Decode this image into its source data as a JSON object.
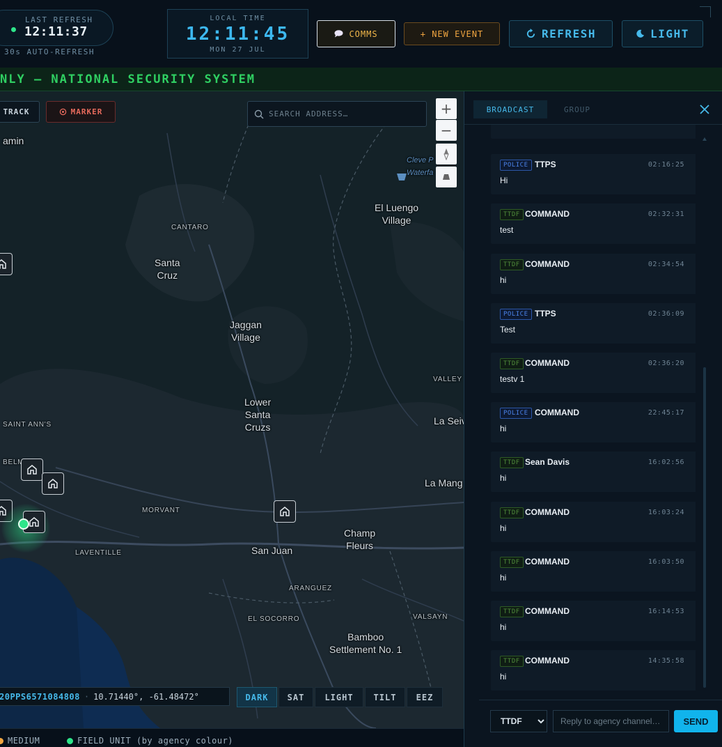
{
  "header": {
    "last_refresh_label": "LAST REFRESH",
    "last_refresh_time": "12:11:37",
    "auto_refresh": "30s AUTO-REFRESH",
    "clock_label": "LOCAL TIME",
    "clock_time": "12:11:45",
    "clock_date": "MON 27 JUL",
    "comms_label": "COMMS",
    "new_event_label": "+ NEW EVENT",
    "refresh_label": "REFRESH",
    "light_label": "LIGHT",
    "accent_color": "#46b9ea"
  },
  "banner": {
    "text": "NLY — NATIONAL SECURITY SYSTEM",
    "color": "#2fcf62"
  },
  "map": {
    "track_label": "TRACK",
    "marker_label": "MARKER",
    "search_placeholder": "SEARCH ADDRESS…",
    "zoom_in": "+",
    "zoom_out": "−",
    "places": {
      "amin": "amin",
      "cantaro": "CANTARO",
      "santa_cruz": "Santa\nCruz",
      "jaggan": "Jaggan\nVillage",
      "el_luengo": "El Luengo\nVillage",
      "cleve": "Cleve P\nWaterfa",
      "lower_santa_cruzs": "Lower\nSanta\nCruzs",
      "saint_anns": "SAINT ANN'S",
      "valley": "VALLEY",
      "la_seiv": "La Seiv",
      "belmont": "BELMONT",
      "la_mang": "La Mang",
      "morvant": "MORVANT",
      "laventille": "LAVENTILLE",
      "san_juan": "San Juan",
      "champ_fleurs": "Champ\nFleurs",
      "aranguez": "ARANGUEZ",
      "el_socorro": "EL SOCORRO",
      "valsayn": "VALSAYN",
      "bamboo": "Bamboo\nSettlement No. 1"
    },
    "coord_id": "20PPS6571084808",
    "coord_sep": "·",
    "coordinates": "10.71440°, -61.48472°",
    "styles": [
      "DARK",
      "SAT",
      "LIGHT",
      "TILT",
      "EEZ"
    ],
    "active_style": "DARK"
  },
  "legend": {
    "medium": "MEDIUM",
    "medium_color": "#f0a540",
    "field_unit": "FIELD UNIT (by agency colour)",
    "field_unit_color": "#2ee58a"
  },
  "comms": {
    "tabs": [
      "BROADCAST",
      "GROUP"
    ],
    "messages": [
      {
        "agency": "POLICE",
        "sender": "TTPS",
        "time": "02:16:25",
        "text": "Hi"
      },
      {
        "agency": "TTDF",
        "sender": "COMMAND",
        "time": "02:32:31",
        "text": "test"
      },
      {
        "agency": "TTDF",
        "sender": "COMMAND",
        "time": "02:34:54",
        "text": "hi"
      },
      {
        "agency": "POLICE",
        "sender": "TTPS",
        "time": "02:36:09",
        "text": "Test"
      },
      {
        "agency": "TTDF",
        "sender": "COMMAND",
        "time": "02:36:20",
        "text": "testv 1"
      },
      {
        "agency": "POLICE",
        "sender": "COMMAND",
        "time": "22:45:17",
        "text": "hi"
      },
      {
        "agency": "TTDF",
        "sender": "Sean Davis",
        "time": "16:02:56",
        "text": "hi"
      },
      {
        "agency": "TTDF",
        "sender": "COMMAND",
        "time": "16:03:24",
        "text": "hi"
      },
      {
        "agency": "TTDF",
        "sender": "COMMAND",
        "time": "16:03:50",
        "text": "hi"
      },
      {
        "agency": "TTDF",
        "sender": "COMMAND",
        "time": "16:14:53",
        "text": "hi"
      },
      {
        "agency": "TTDF",
        "sender": "COMMAND",
        "time": "14:35:58",
        "text": "hi"
      }
    ],
    "reply_agency": "TTDF",
    "reply_options": [
      "TTDF"
    ],
    "reply_placeholder": "Reply to agency channel…",
    "send_label": "SEND"
  }
}
